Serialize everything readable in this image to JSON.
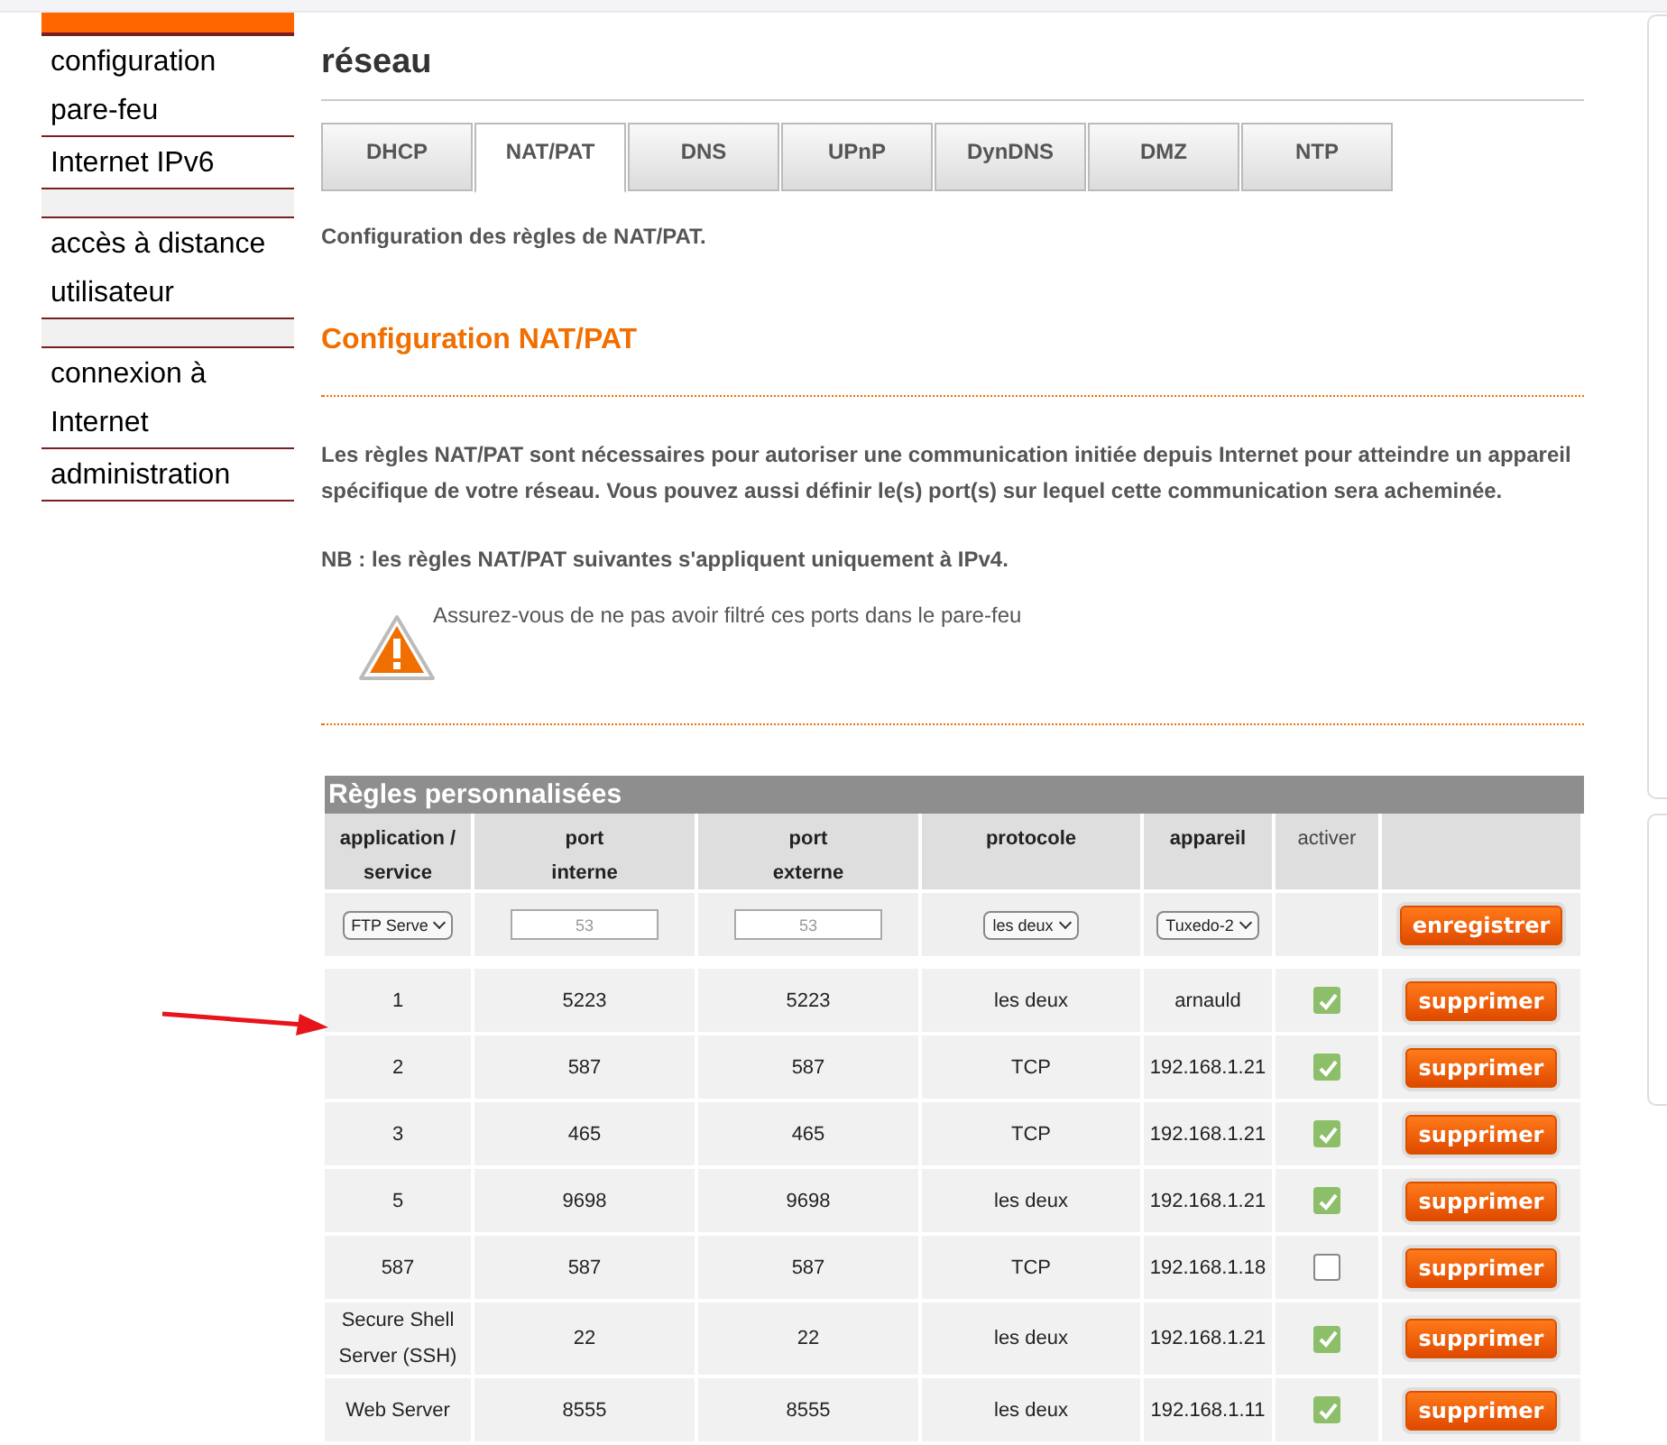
{
  "sidebar": {
    "items": [
      {
        "label": "configuration pare-feu",
        "kind": "link"
      },
      {
        "label": "Internet IPv6",
        "kind": "link"
      },
      {
        "kind": "spacer"
      },
      {
        "label": "accès à distance utilisateur",
        "kind": "link"
      },
      {
        "kind": "spacer"
      },
      {
        "label": "connexion à Internet",
        "kind": "link"
      },
      {
        "label": "administration",
        "kind": "link"
      }
    ]
  },
  "page_title": "réseau",
  "tabs": [
    {
      "label": "DHCP",
      "selected": false
    },
    {
      "label": "NAT/PAT",
      "selected": true
    },
    {
      "label": "DNS",
      "selected": false
    },
    {
      "label": "UPnP",
      "selected": false
    },
    {
      "label": "DynDNS",
      "selected": false
    },
    {
      "label": "DMZ",
      "selected": false
    },
    {
      "label": "NTP",
      "selected": false
    }
  ],
  "intro": "Configuration des règles de NAT/PAT.",
  "section_title": "Configuration NAT/PAT",
  "description": "Les règles NAT/PAT sont nécessaires pour autoriser une communication initiée depuis Internet pour atteindre un appareil spécifique de votre réseau. Vous pouvez aussi définir le(s) port(s) sur lequel cette communication sera acheminée.",
  "note": "NB : les règles NAT/PAT suivantes s'appliquent uniquement à IPv4.",
  "warning": "Assurez-vous de ne pas avoir filtré ces ports dans le pare-feu",
  "table": {
    "title": "Règles personnalisées",
    "columns": [
      [
        "application /",
        "service"
      ],
      [
        "port",
        "interne"
      ],
      [
        "port",
        "externe"
      ],
      [
        "protocole"
      ],
      [
        "appareil"
      ],
      [
        "activer"
      ],
      []
    ],
    "form": {
      "service": "FTP Serve",
      "internal_placeholder": "53",
      "external_placeholder": "53",
      "protocol": "les deux",
      "device": "Tuxedo-2",
      "button": "enregistrer"
    },
    "rows": [
      {
        "service": "1",
        "internal": "5223",
        "external": "5223",
        "protocol": "les deux",
        "device": "arnauld",
        "checked": true,
        "button": "supprimer"
      },
      {
        "service": "2",
        "internal": "587",
        "external": "587",
        "protocol": "TCP",
        "device": "192.168.1.21",
        "checked": true,
        "button": "supprimer"
      },
      {
        "service": "3",
        "internal": "465",
        "external": "465",
        "protocol": "TCP",
        "device": "192.168.1.21",
        "checked": true,
        "button": "supprimer"
      },
      {
        "service": "5",
        "internal": "9698",
        "external": "9698",
        "protocol": "les deux",
        "device": "192.168.1.21",
        "checked": true,
        "button": "supprimer"
      },
      {
        "service": "587",
        "internal": "587",
        "external": "587",
        "protocol": "TCP",
        "device": "192.168.1.18",
        "checked": false,
        "button": "supprimer"
      },
      {
        "service": "Secure Shell Server (SSH)",
        "internal": "22",
        "external": "22",
        "protocol": "les deux",
        "device": "192.168.1.21",
        "checked": true,
        "button": "supprimer"
      },
      {
        "service": "Web Server",
        "internal": "8555",
        "external": "8555",
        "protocol": "les deux",
        "device": "192.168.1.11",
        "checked": true,
        "button": "supprimer"
      }
    ]
  }
}
